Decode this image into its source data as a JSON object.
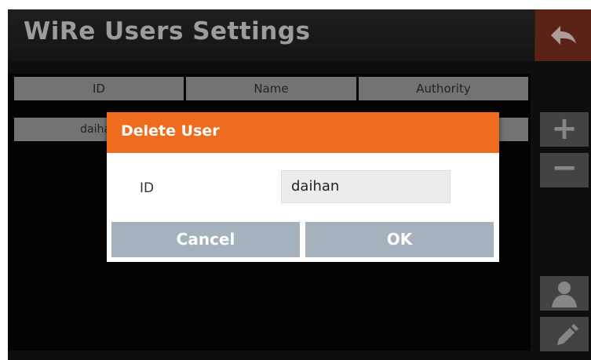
{
  "app": {
    "title": "WiRe Users Settings"
  },
  "table": {
    "headers": [
      "ID",
      "Name",
      "Authority"
    ],
    "rows": [
      {
        "id": "daihan",
        "name": "",
        "authority": ""
      }
    ]
  },
  "dialog": {
    "title": "Delete User",
    "field_label": "ID",
    "field_value": "daihan",
    "cancel_label": "Cancel",
    "ok_label": "OK"
  },
  "side_buttons": {
    "add_glyph": "+",
    "remove_glyph": "−"
  },
  "colors": {
    "accent": "#ef6b1d",
    "back_button": "#7a2f1c",
    "dialog_buttons": "#a5b1bc"
  },
  "icons": [
    "back-arrow-icon",
    "plus-icon",
    "minus-icon",
    "user-icon",
    "pencil-icon"
  ]
}
